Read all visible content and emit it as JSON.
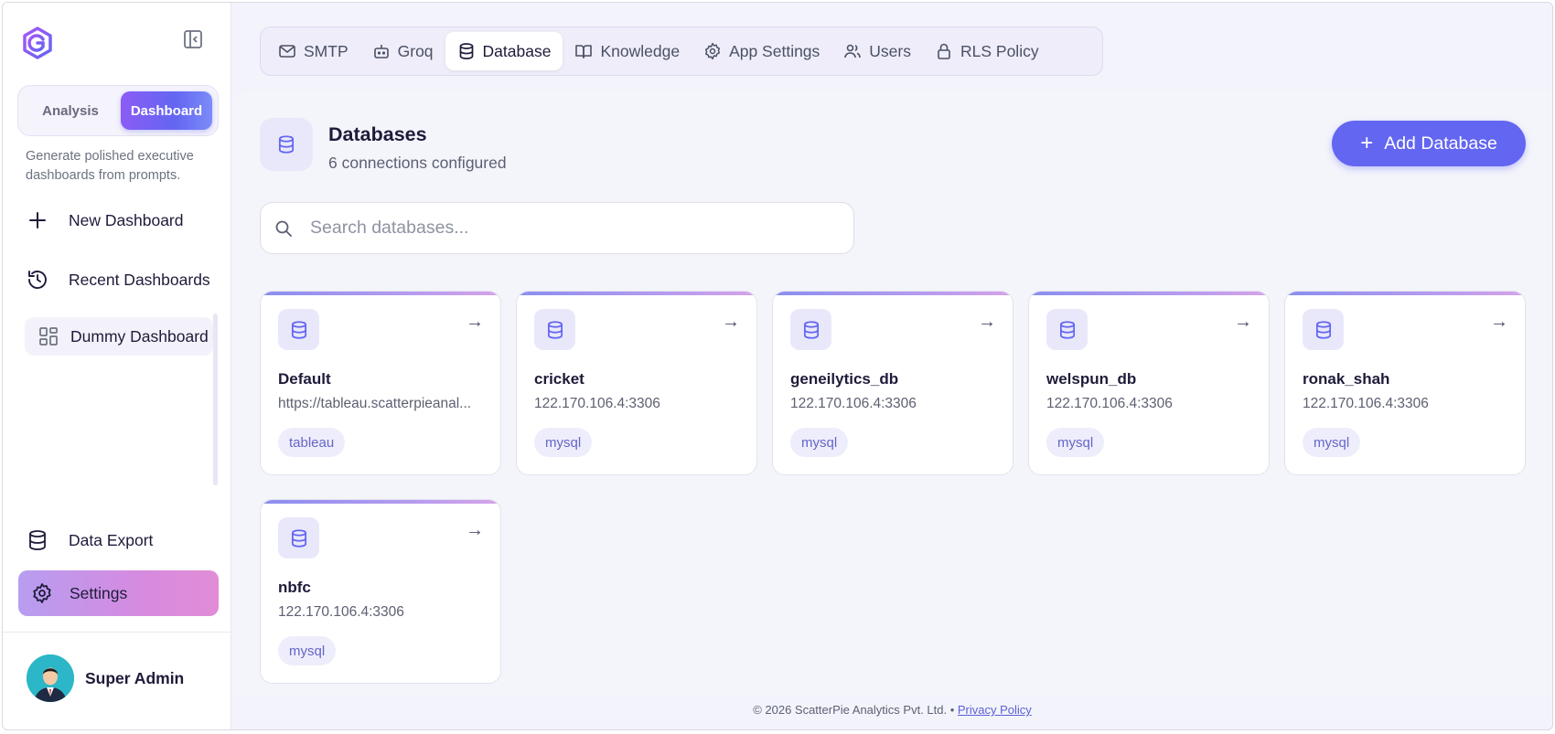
{
  "sidebar": {
    "modes": [
      "Analysis",
      "Dashboard"
    ],
    "active_mode": "Dashboard",
    "tagline": "Generate polished executive dashboards from prompts.",
    "nav": {
      "new_dashboard": "New Dashboard",
      "recent_dashboards": "Recent Dashboards",
      "dummy_dashboard": "Dummy Dashboard",
      "data_export": "Data Export",
      "settings": "Settings"
    },
    "user_name": "Super Admin",
    "icons": [
      "logo-icon",
      "collapse-sidebar-icon",
      "plus-icon",
      "history-icon",
      "dashboard-grid-icon",
      "database-icon",
      "gear-icon"
    ]
  },
  "tabs": [
    {
      "label": "SMTP",
      "icon": "mail-icon"
    },
    {
      "label": "Groq",
      "icon": "bot-icon"
    },
    {
      "label": "Database",
      "icon": "database-icon",
      "active": true
    },
    {
      "label": "Knowledge",
      "icon": "book-icon"
    },
    {
      "label": "App Settings",
      "icon": "gear-icon"
    },
    {
      "label": "Users",
      "icon": "users-icon"
    },
    {
      "label": "RLS Policy",
      "icon": "lock-icon"
    }
  ],
  "page": {
    "title": "Databases",
    "subtitle": "6 connections configured",
    "add_button": "Add Database",
    "search_placeholder": "Search databases..."
  },
  "databases": [
    {
      "name": "Default",
      "host": "https://tableau.scatterpieanal...",
      "type": "tableau"
    },
    {
      "name": "cricket",
      "host": "122.170.106.4:3306",
      "type": "mysql"
    },
    {
      "name": "geneilytics_db",
      "host": "122.170.106.4:3306",
      "type": "mysql"
    },
    {
      "name": "welspun_db",
      "host": "122.170.106.4:3306",
      "type": "mysql"
    },
    {
      "name": "ronak_shah",
      "host": "122.170.106.4:3306",
      "type": "mysql"
    },
    {
      "name": "nbfc",
      "host": "122.170.106.4:3306",
      "type": "mysql"
    }
  ],
  "footer": {
    "copyright": "© 2026 ScatterPie Analytics Pvt. Ltd. •",
    "privacy_link": "Privacy Policy"
  },
  "colors": {
    "accent": "#6366f1",
    "settings_gradient_start": "#b79df0",
    "settings_gradient_end": "#e28cd6",
    "tag_bg": "#eeedfb",
    "tag_text": "#6366c8"
  }
}
